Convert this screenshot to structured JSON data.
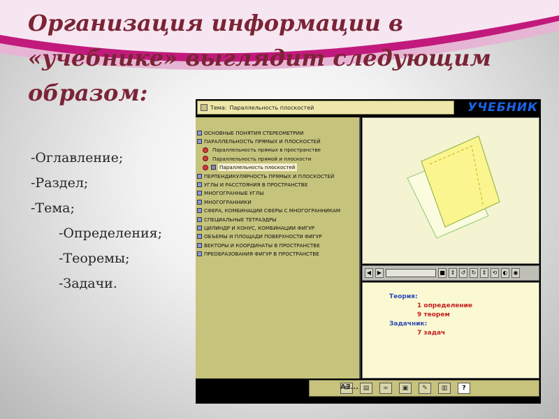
{
  "slide": {
    "title": "Организация информации в «учебнике» выглядит следующим образом:",
    "list": [
      "-Оглавление;",
      "-Раздел;",
      "-Тема;",
      "-Определения;",
      "-Теоремы;",
      "-Задачи."
    ]
  },
  "app": {
    "header_label": "Тема:",
    "header_topic": "Параллельность плоскостей",
    "logo": "УЧЕБНИК",
    "toc": [
      {
        "label": "ОСНОВНЫЕ ПОНЯТИЯ СТЕРЕОМЕТРИИ"
      },
      {
        "label": "ПАРАЛЛЕЛЬНОСТЬ ПРЯМЫХ И ПЛОСКОСТЕЙ"
      },
      {
        "label": "Параллельность прямых в пространстве"
      },
      {
        "label": "Параллельность прямой и плоскости"
      },
      {
        "label": "Параллельность плоскостей"
      },
      {
        "label": "ПЕРПЕНДИКУЛЯРНОСТЬ ПРЯМЫХ И ПЛОСКОСТЕЙ"
      },
      {
        "label": "УГЛЫ И РАССТОЯНИЯ В ПРОСТРАНСТВЕ"
      },
      {
        "label": "МНОГОГРАННЫЕ УГЛЫ"
      },
      {
        "label": "МНОГОГРАННИКИ"
      },
      {
        "label": "СФЕРА, КОМБИНАЦИИ СФЕРЫ С МНОГОГРАННИКАМ"
      },
      {
        "label": "СПЕЦИАЛЬНЫЕ ТЕТРАЭДРЫ"
      },
      {
        "label": "ЦИЛИНДР И КОНУС, КОМБИНАЦИИ ФИГУР"
      },
      {
        "label": "ОБЪЕМЫ И ПЛОЩАДИ ПОВЕРХНОСТИ ФИГУР"
      },
      {
        "label": "ВЕКТОРЫ И КООРДИНАТЫ В ПРОСТРАНСТВЕ"
      },
      {
        "label": "ПРЕОБРАЗОВАНИЯ ФИГУР В ПРОСТРАНСТВЕ"
      }
    ],
    "info": {
      "theory_label": "Теория:",
      "definitions": "1 определение",
      "theorems": "9 теорем",
      "tasks_label": "Задачник:",
      "tasks": "7 задач"
    },
    "bottom_label": "...ЕА",
    "colors": {
      "title": "#7a2436",
      "toc_bg": "#c6c37c",
      "logo": "#1a64e8",
      "info_heading": "#2c48b8",
      "info_value": "#c41f1f"
    }
  }
}
